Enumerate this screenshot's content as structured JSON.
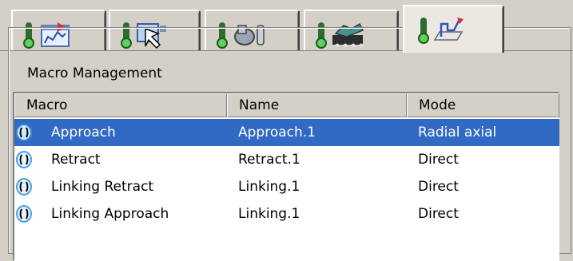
{
  "tabs": [
    {
      "icon": "machine-icon",
      "active": false
    },
    {
      "icon": "tool-selection-icon",
      "active": false
    },
    {
      "icon": "tool-assembly-icon",
      "active": false
    },
    {
      "icon": "feeds-speeds-icon",
      "active": false
    },
    {
      "icon": "macro-path-icon",
      "active": true
    }
  ],
  "group": {
    "label": "Macro Management"
  },
  "columns": [
    "Macro",
    "Name",
    "Mode"
  ],
  "rows": [
    {
      "macro": "Approach",
      "name": "Approach.1",
      "mode": "Radial axial",
      "selected": true
    },
    {
      "macro": "Retract",
      "name": "Retract.1",
      "mode": "Direct",
      "selected": false
    },
    {
      "macro": "Linking Retract",
      "name": "Linking.1",
      "mode": "Direct",
      "selected": false
    },
    {
      "macro": "Linking Approach",
      "name": "Linking.1",
      "mode": "Direct",
      "selected": false
    }
  ],
  "colors": {
    "selection": "#316ac5",
    "face": "#d4d0c8"
  }
}
